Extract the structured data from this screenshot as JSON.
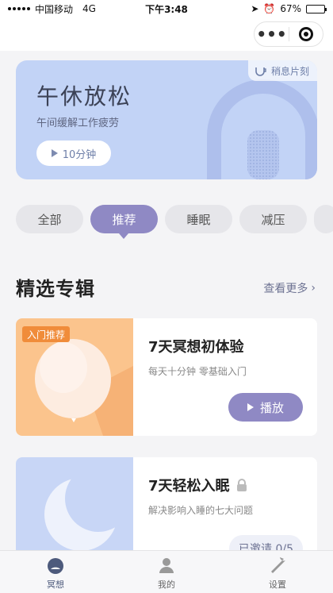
{
  "status_bar": {
    "carrier": "中国移动",
    "network": "4G",
    "time": "下午3:48",
    "battery": "67%",
    "battery_level": 0.67
  },
  "hero": {
    "title": "午休放松",
    "subtitle": "午间缓解工作疲劳",
    "duration": "10分钟",
    "badge": "稍息片刻",
    "bg_color": "#c2d3f6"
  },
  "categories": [
    {
      "label": "全部",
      "active": false
    },
    {
      "label": "推荐",
      "active": true
    },
    {
      "label": "睡眠",
      "active": false
    },
    {
      "label": "减压",
      "active": false
    }
  ],
  "section": {
    "title": "精选专辑",
    "more": "查看更多"
  },
  "albums": [
    {
      "title": "7天冥想初体验",
      "subtitle": "每天十分钟 零基础入门",
      "tag": "入门推荐",
      "action": "播放",
      "locked": false
    },
    {
      "title": "7天轻松入眠",
      "subtitle": "解决影响入睡的七大问题",
      "invite_status": "已邀请 0/5",
      "locked": true
    }
  ],
  "tabbar": [
    {
      "label": "冥想",
      "icon": "meditation-icon",
      "active": true
    },
    {
      "label": "我的",
      "icon": "profile-icon",
      "active": false
    },
    {
      "label": "设置",
      "icon": "wrench-icon",
      "active": false
    }
  ],
  "colors": {
    "accent": "#8f89c4",
    "orange": "#f08c3a"
  }
}
